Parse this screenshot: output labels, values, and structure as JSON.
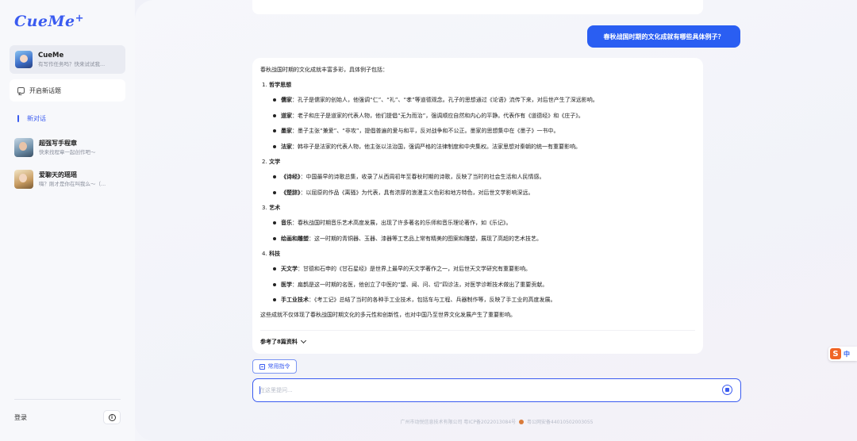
{
  "sidebar": {
    "logo": "CueMe",
    "profile": {
      "name": "CueMe",
      "subtitle": "有写作任务吗？快来试试我..."
    },
    "new_topic_label": "开启新话题",
    "new_chat_label": "新对话",
    "conversations": [
      {
        "name": "超强写手程章",
        "preview": "快来找程章一起创作吧～"
      },
      {
        "name": "爱聊天的瑶瑶",
        "preview": "嗨？刚才是你在叫我么～（..."
      }
    ],
    "login_label": "登录"
  },
  "chat": {
    "user_message": "春秋战国时期的文化成就有哪些具体例子？",
    "answer": {
      "intro": "春秋战国时期的文化成就丰富多彩，具体例子包括：",
      "sections": [
        {
          "num": "1.",
          "title": "哲学思想",
          "items": [
            {
              "term": "儒家",
              "text": "：孔子是儒家的创始人，他强调“仁”、“礼”、“孝”等道德观念。孔子的思想通过《论语》流传下来，对后世产生了深远影响。"
            },
            {
              "term": "道家",
              "text": "：老子和庄子是道家的代表人物，他们提倡“无为而治”，强调顺应自然和内心的平静。代表作有《道德经》和《庄子》。"
            },
            {
              "term": "墨家",
              "text": "：墨子主张“兼爱”、“非攻”，提倡普遍的爱与和平，反对战争和不公正。墨家的思想集中在《墨子》一书中。"
            },
            {
              "term": "法家",
              "text": "：韩非子是法家的代表人物，他主张以法治国，强调严格的法律制度和中央集权。法家思想对秦朝的统一有重要影响。"
            }
          ]
        },
        {
          "num": "2.",
          "title": "文学",
          "items": [
            {
              "term": "《诗经》",
              "text": "：中国最早的诗歌总集，收录了从西周初年至春秋时期的诗歌，反映了当时的社会生活和人民情感。"
            },
            {
              "term": "《楚辞》",
              "text": "：以屈原的作品《离骚》为代表，具有浓厚的浪漫主义色彩和地方特色，对后世文学影响深远。"
            }
          ]
        },
        {
          "num": "3.",
          "title": "艺术",
          "items": [
            {
              "term": "音乐",
              "text": "：春秋战国时期音乐艺术高度发展，出现了许多著名的乐师和音乐理论著作，如《乐记》。"
            },
            {
              "term": "绘画和雕塑",
              "text": "：这一时期的青铜器、玉器、漆器等工艺品上常有精美的图案和雕塑，展现了高超的艺术技艺。"
            }
          ]
        },
        {
          "num": "4.",
          "title": "科技",
          "items": [
            {
              "term": "天文学",
              "text": "：甘德和石申的《甘石星经》是世界上最早的天文学著作之一，对后世天文学研究有重要影响。"
            },
            {
              "term": "医学",
              "text": "：扁鹊是这一时期的名医，他创立了中医的“望、闻、问、切”四诊法，对医学诊断技术做出了重要贡献。"
            },
            {
              "term": "手工业技术",
              "text": "：《考工记》总结了当时的各种手工业技术，包括车与工程、兵器制作等，反映了手工业的高度发展。"
            }
          ]
        }
      ],
      "outro": "这些成就不仅体现了春秋战国时期文化的多元性和创新性，也对中国乃至世界文化发展产生了重要影响。",
      "refs_label": "参考了8篇资料"
    },
    "command_button": "常用指令",
    "input_placeholder": "在这里提问...",
    "footer": {
      "company": "广州市动悦信息技术有限公司 粤ICP备2022013084号",
      "police": "粤公网安备44010502003055"
    }
  },
  "ime": {
    "badge": "S",
    "label": "中"
  },
  "colors": {
    "accent": "#2a5ef2",
    "logo": "#3a5bf0"
  }
}
